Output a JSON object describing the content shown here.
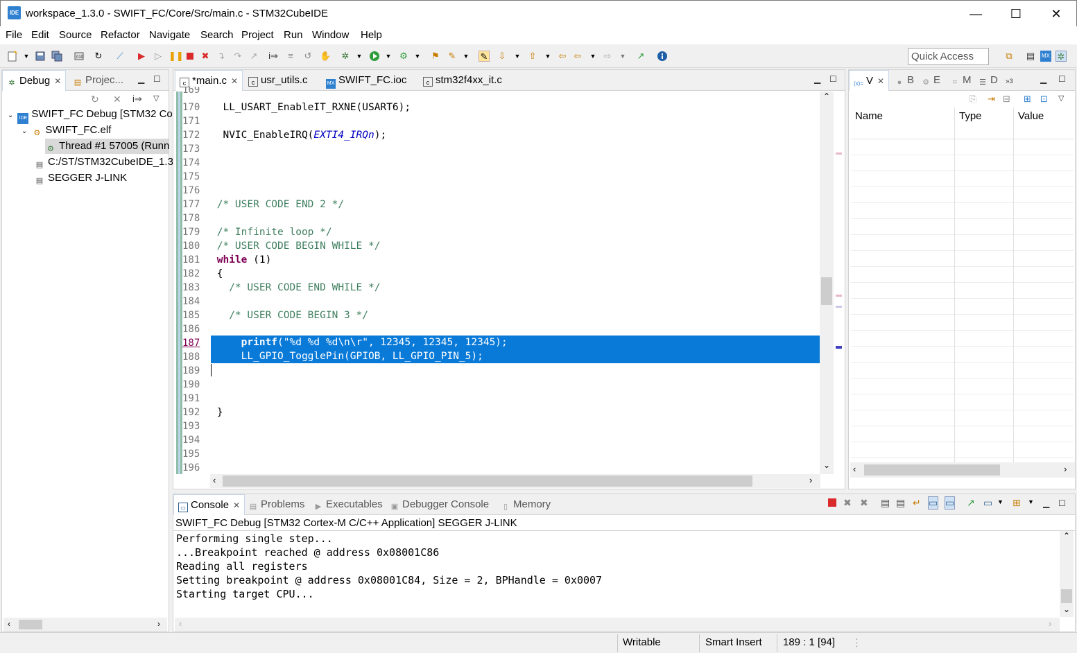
{
  "window": {
    "title": "workspace_1.3.0 - SWIFT_FC/Core/Src/main.c - STM32CubeIDE",
    "app_icon_label": "IDE",
    "minimize": "—",
    "maximize": "☐",
    "close": "✕"
  },
  "menu": [
    "File",
    "Edit",
    "Source",
    "Refactor",
    "Navigate",
    "Search",
    "Project",
    "Run",
    "Window",
    "Help"
  ],
  "toolbar": {
    "quick_access_placeholder": "Quick Access"
  },
  "debug_panel": {
    "tabs": [
      {
        "label": "Debug",
        "active": true
      },
      {
        "label": "Projec...",
        "active": false
      }
    ],
    "tree": [
      {
        "label": "SWIFT_FC Debug [STM32 Co",
        "level": 0,
        "expanded": true
      },
      {
        "label": "SWIFT_FC.elf",
        "level": 1,
        "expanded": true
      },
      {
        "label": "Thread #1 57005 (Runn",
        "level": 2
      },
      {
        "label": "C:/ST/STM32CubeIDE_1.3.",
        "level": 1
      },
      {
        "label": "SEGGER J-LINK",
        "level": 1
      }
    ]
  },
  "editor": {
    "tabs": [
      {
        "label": "*main.c",
        "active": true,
        "closable": true
      },
      {
        "label": "usr_utils.c",
        "active": false
      },
      {
        "label": "SWIFT_FC.ioc",
        "active": false
      },
      {
        "label": "stm32f4xx_it.c",
        "active": false
      }
    ],
    "line_numbers": [
      "169",
      "170",
      "171",
      "172",
      "173",
      "174",
      "175",
      "176",
      "177",
      "178",
      "179",
      "180",
      "181",
      "182",
      "183",
      "184",
      "185",
      "186",
      "187",
      "188",
      "189",
      "190",
      "191",
      "192",
      "193",
      "194",
      "195",
      "196"
    ],
    "lines": {
      "l170": "  LL_USART_EnableIT_RXNE(USART6);",
      "l172a": "  NVIC_EnableIRQ(",
      "l172b": "EXTI4_IRQn",
      "l172c": ");",
      "l177": " /* USER CODE END 2 */",
      "l179": " /* Infinite loop */",
      "l180": " /* USER CODE BEGIN WHILE */",
      "l181a": " while",
      "l181b": " (1)",
      "l182": " {",
      "l183": "   /* USER CODE END WHILE */",
      "l185": "   /* USER CODE BEGIN 3 */",
      "l187a": "     printf",
      "l187b": "(\"%d %d %d\\n\\r\", 12345, 12345, 12345);",
      "l188": "     LL_GPIO_TogglePin(GPIOB, LL_GPIO_PIN_5);",
      "l192": " }"
    }
  },
  "variables_panel": {
    "tabs": [
      "V",
      "B",
      "E",
      "M",
      "D",
      "3"
    ],
    "columns": [
      "Name",
      "Type",
      "Value"
    ]
  },
  "console": {
    "tabs": [
      {
        "label": "Console",
        "active": true
      },
      {
        "label": "Problems",
        "active": false
      },
      {
        "label": "Executables",
        "active": false
      },
      {
        "label": "Debugger Console",
        "active": false
      },
      {
        "label": "Memory",
        "active": false
      }
    ],
    "header": "SWIFT_FC Debug [STM32 Cortex-M C/C++ Application] SEGGER J-LINK",
    "lines": [
      "Performing single step...",
      "...Breakpoint reached @ address 0x08001C86",
      "Reading all registers",
      "Setting breakpoint @ address 0x08001C84, Size = 2, BPHandle = 0x0007",
      "Starting target CPU..."
    ]
  },
  "status": {
    "writable": "Writable",
    "insert_mode": "Smart Insert",
    "position": "189 : 1 [94]"
  },
  "colors": {
    "selection": "#0a7ad8",
    "comment": "#3f7f5f",
    "keyword": "#7f0055",
    "macro": "#0000c0",
    "terminate_red": "#d92b2b",
    "accent_blue": "#2f80d1"
  }
}
